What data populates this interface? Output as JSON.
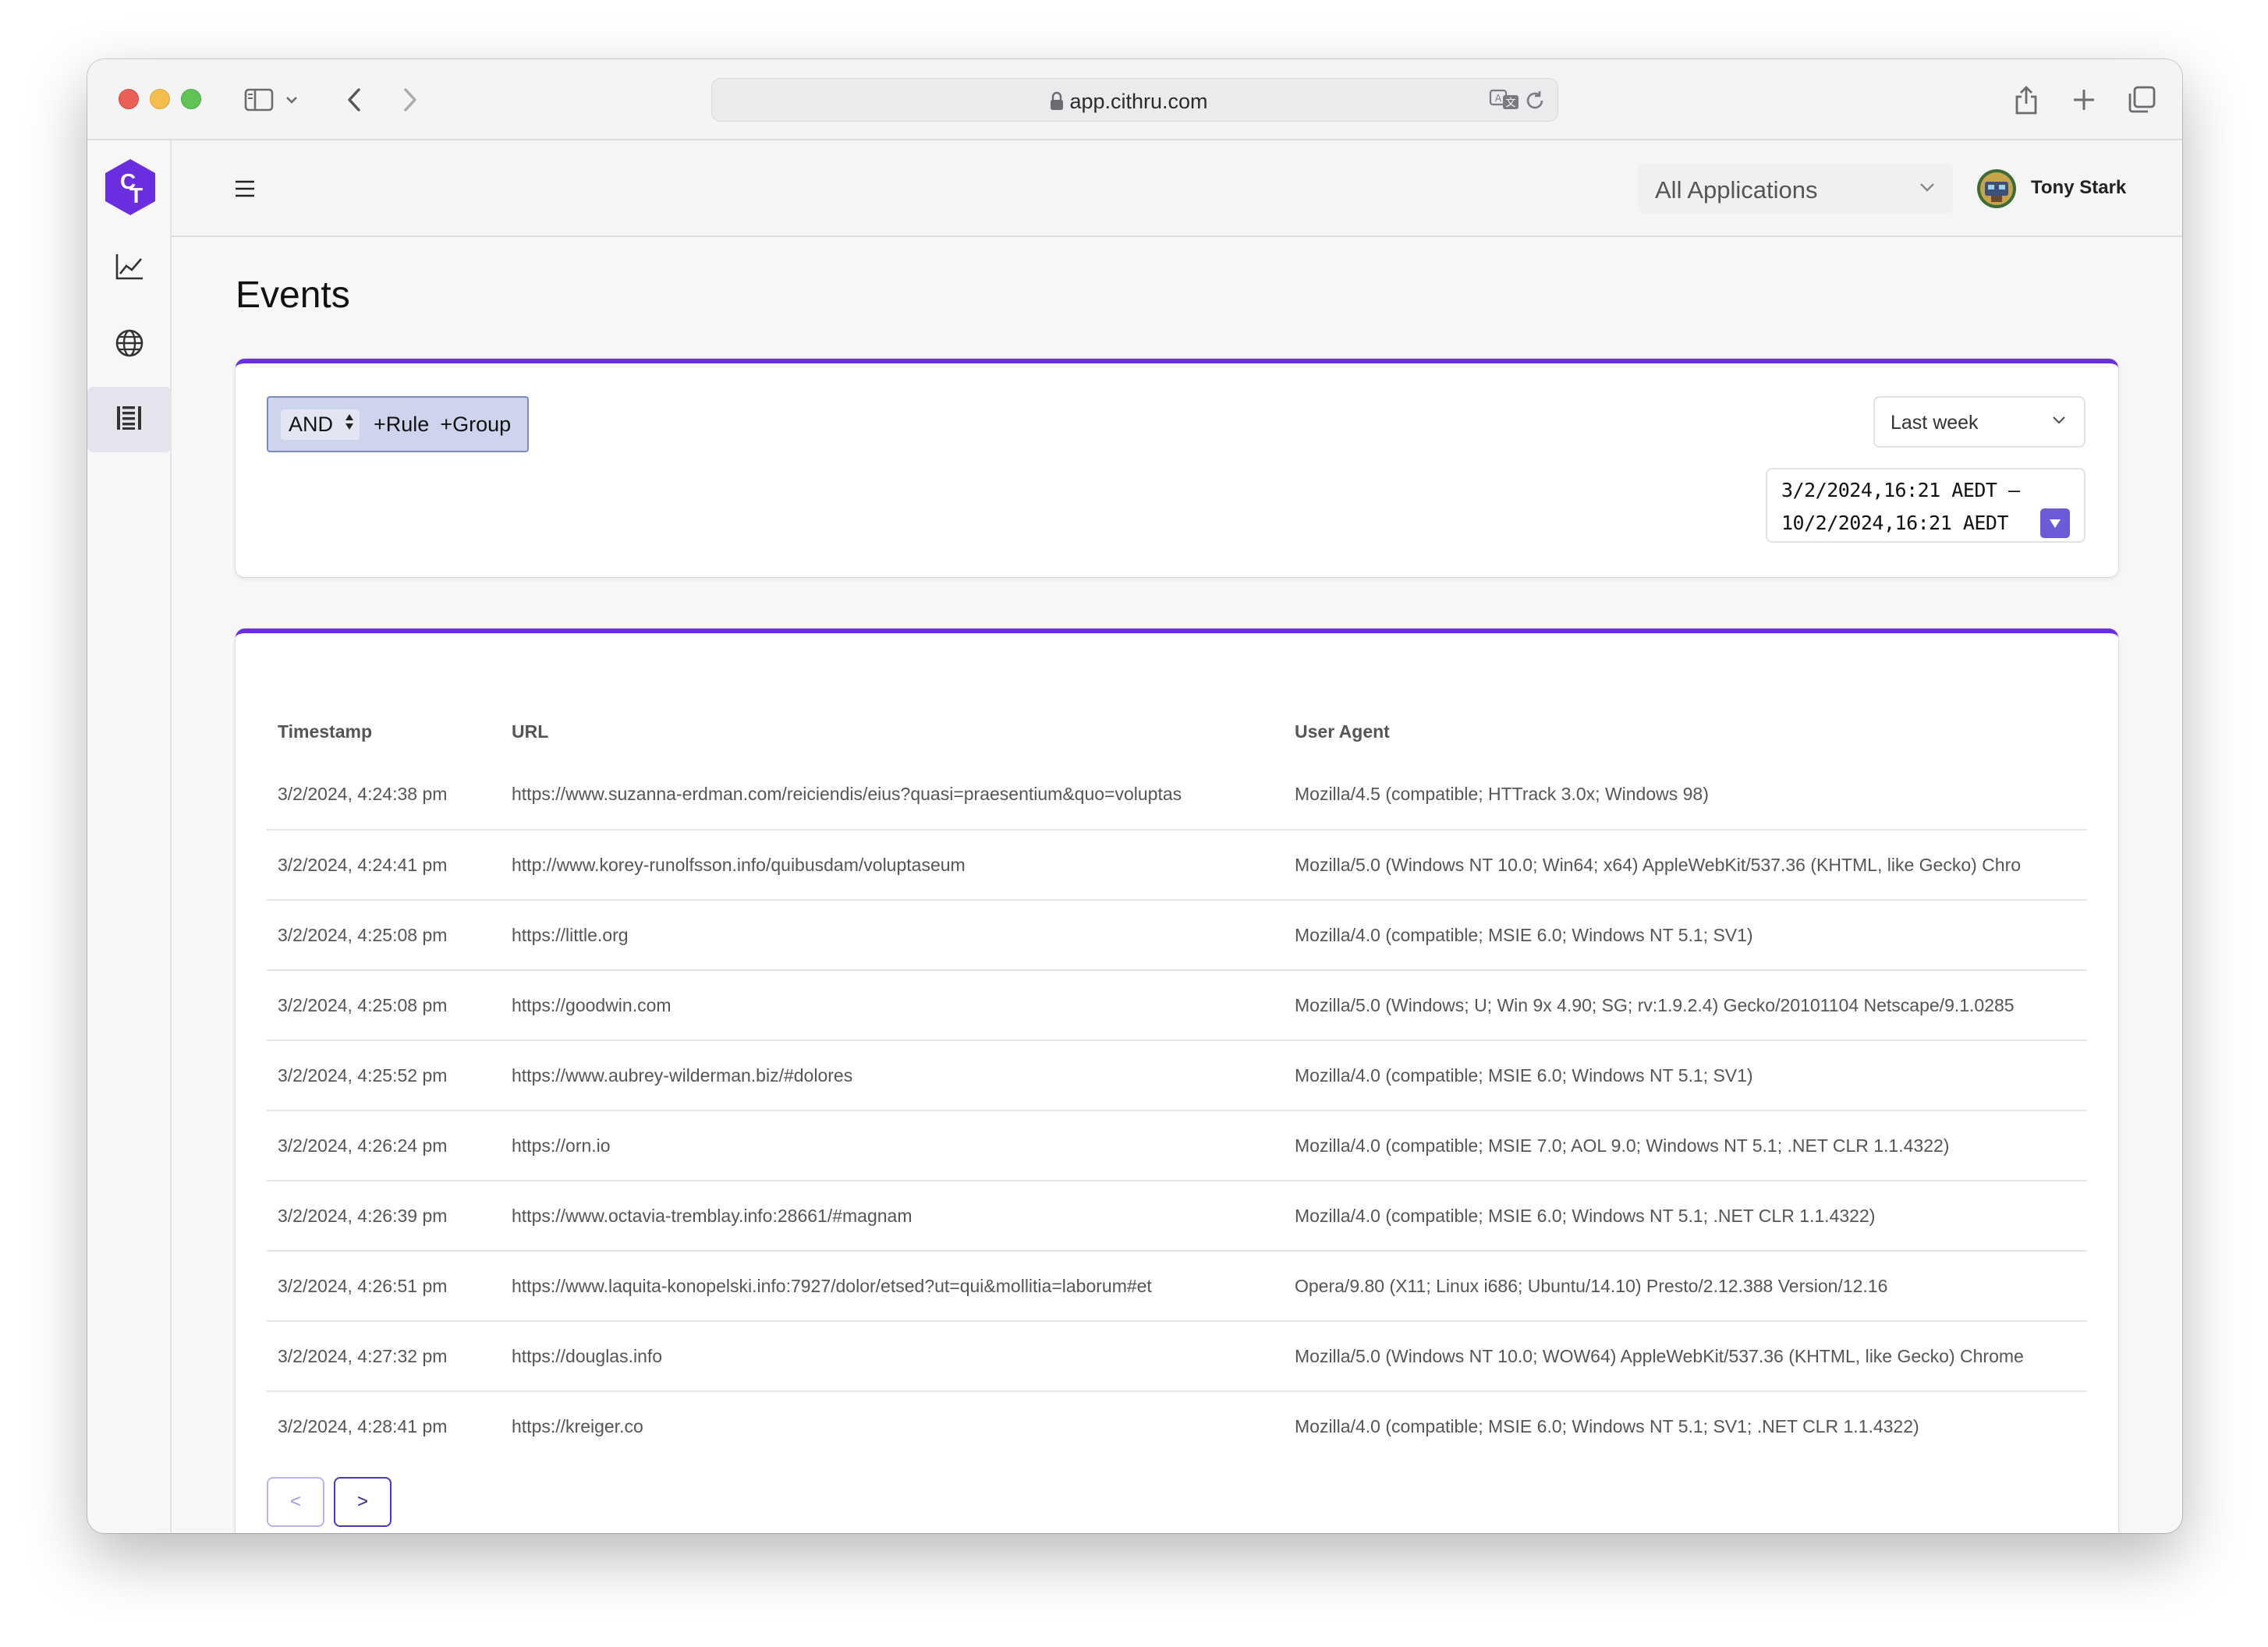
{
  "browser": {
    "url": "app.cithru.com"
  },
  "header": {
    "app_selector": "All Applications",
    "user_name": "Tony Stark"
  },
  "sidebar": {
    "items": [
      {
        "icon": "line-chart-icon"
      },
      {
        "icon": "globe-icon"
      },
      {
        "icon": "events-list-icon",
        "active": true
      }
    ]
  },
  "page": {
    "title": "Events"
  },
  "filter": {
    "combinator": "AND",
    "add_rule": "+Rule",
    "add_group": "+Group",
    "range": "Last week",
    "start": "3/2/2024,16:21 AEDT –",
    "end": "10/2/2024,16:21 AEDT"
  },
  "table": {
    "columns": [
      "Timestamp",
      "URL",
      "User Agent"
    ],
    "rows": [
      {
        "ts": "3/2/2024, 4:24:38 pm",
        "url": "https://www.suzanna-erdman.com/reiciendis/eius?quasi=praesentium&quo=voluptas",
        "ua": "Mozilla/4.5 (compatible; HTTrack 3.0x; Windows 98)"
      },
      {
        "ts": "3/2/2024, 4:24:41 pm",
        "url": "http://www.korey-runolfsson.info/quibusdam/voluptaseum",
        "ua": "Mozilla/5.0 (Windows NT 10.0; Win64; x64) AppleWebKit/537.36 (KHTML, like Gecko) Chro"
      },
      {
        "ts": "3/2/2024, 4:25:08 pm",
        "url": "https://little.org",
        "ua": "Mozilla/4.0 (compatible; MSIE 6.0; Windows NT 5.1; SV1)"
      },
      {
        "ts": "3/2/2024, 4:25:08 pm",
        "url": "https://goodwin.com",
        "ua": "Mozilla/5.0 (Windows; U; Win 9x 4.90; SG; rv:1.9.2.4) Gecko/20101104 Netscape/9.1.0285"
      },
      {
        "ts": "3/2/2024, 4:25:52 pm",
        "url": "https://www.aubrey-wilderman.biz/#dolores",
        "ua": "Mozilla/4.0 (compatible; MSIE 6.0; Windows NT 5.1; SV1)"
      },
      {
        "ts": "3/2/2024, 4:26:24 pm",
        "url": "https://orn.io",
        "ua": "Mozilla/4.0 (compatible; MSIE 7.0; AOL 9.0; Windows NT 5.1; .NET CLR 1.1.4322)"
      },
      {
        "ts": "3/2/2024, 4:26:39 pm",
        "url": "https://www.octavia-tremblay.info:28661/#magnam",
        "ua": "Mozilla/4.0 (compatible; MSIE 6.0; Windows NT 5.1; .NET CLR 1.1.4322)"
      },
      {
        "ts": "3/2/2024, 4:26:51 pm",
        "url": "https://www.laquita-konopelski.info:7927/dolor/etsed?ut=qui&mollitia=laborum#et",
        "ua": "Opera/9.80 (X11; Linux i686; Ubuntu/14.10) Presto/2.12.388 Version/12.16"
      },
      {
        "ts": "3/2/2024, 4:27:32 pm",
        "url": "https://douglas.info",
        "ua": "Mozilla/5.0 (Windows NT 10.0; WOW64) AppleWebKit/537.36 (KHTML, like Gecko) Chrome"
      },
      {
        "ts": "3/2/2024, 4:28:41 pm",
        "url": "https://kreiger.co",
        "ua": "Mozilla/4.0 (compatible; MSIE 6.0; Windows NT 5.1; SV1; .NET CLR 1.1.4322)"
      }
    ]
  },
  "pagination": {
    "prev": "<",
    "next": ">"
  },
  "colors": {
    "accent": "#6a2ee0",
    "active_nav_bg": "#e3e4ec",
    "query_builder_bg": "#ced4ec"
  }
}
